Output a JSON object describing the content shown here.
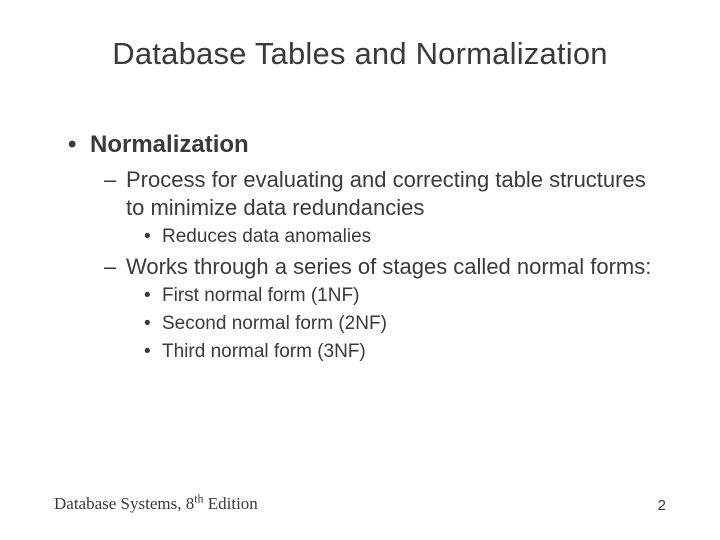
{
  "title": "Database Tables and Normalization",
  "bullets": {
    "l1": "Normalization",
    "l2a": "Process for evaluating and correcting table structures to minimize data redundancies",
    "l3a": "Reduces data anomalies",
    "l2b": "Works through a series of stages called normal forms:",
    "l3b": "First normal form (1NF)",
    "l3c": "Second normal form (2NF)",
    "l3d": "Third normal form (3NF)"
  },
  "footer": {
    "book_prefix": "Database Systems, 8",
    "book_sup": "th",
    "book_suffix": " Edition",
    "page": "2"
  }
}
